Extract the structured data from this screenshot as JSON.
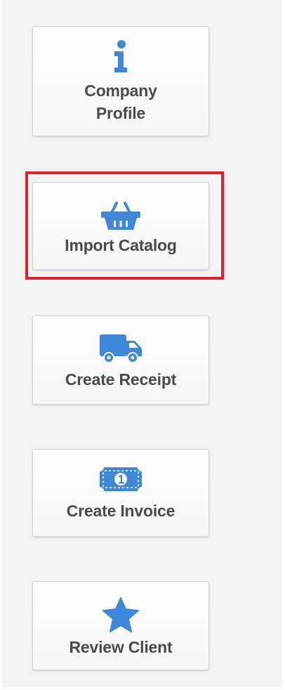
{
  "accent_color": "#3f87d9",
  "highlight_color": "#e0202a",
  "highlighted_item": "Import Catalog",
  "menu": {
    "items": [
      {
        "icon": "info-icon",
        "label": "Company\nProfile"
      },
      {
        "icon": "basket-icon",
        "label": "Import Catalog"
      },
      {
        "icon": "truck-icon",
        "label": "Create Receipt"
      },
      {
        "icon": "money-bill-icon",
        "label": "Create Invoice"
      },
      {
        "icon": "star-icon",
        "label": "Review Client"
      }
    ]
  }
}
